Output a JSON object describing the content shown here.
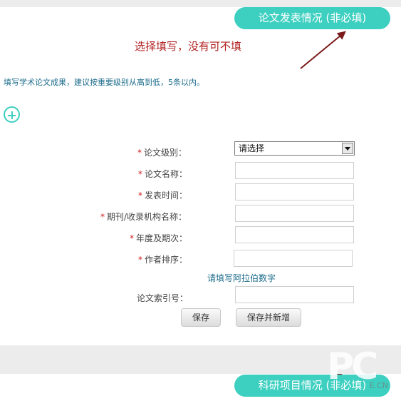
{
  "sections": {
    "publish_title": "论文发表情况 (非必填)",
    "research_title": "科研项目情况 (非必填)"
  },
  "annotation": "选择填写，没有可不填",
  "hint": "填写学术论文成果，建议按重要级别从高到低，5条以内。",
  "form": {
    "required_mark": "*",
    "level_label": "论文级别：",
    "level_selected": "请选择",
    "name_label": "论文名称：",
    "date_label": "发表时间：",
    "journal_label": "期刊/收录机构名称：",
    "issue_label": "年度及期次：",
    "author_rank_label": "作者排序：",
    "author_rank_note": "请填写阿拉伯数字",
    "index_label": "论文索引号：",
    "save_label": "保存",
    "save_new_label": "保存并新增"
  },
  "watermark": {
    "logo": "PC",
    "text": "E.CN"
  },
  "colors": {
    "accent": "#3dcfc0",
    "annotation": "#b22222",
    "required": "#cc2222",
    "hint": "#1a6a8a"
  },
  "icons": {
    "add": "plus-circle-icon",
    "select_arrow": "chevron-down-icon"
  }
}
